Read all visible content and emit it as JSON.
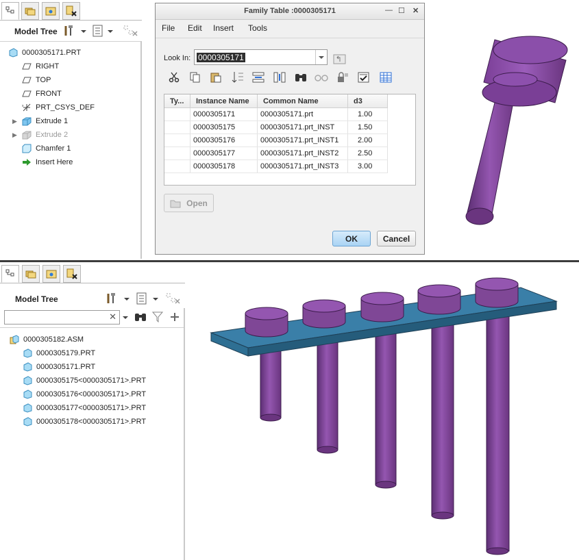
{
  "top": {
    "tree_title": "Model Tree",
    "tree": [
      {
        "label": "0000305171.PRT",
        "icon": "part-icon"
      },
      {
        "label": "RIGHT",
        "icon": "datum-plane-icon"
      },
      {
        "label": "TOP",
        "icon": "datum-plane-icon"
      },
      {
        "label": "FRONT",
        "icon": "datum-plane-icon"
      },
      {
        "label": "PRT_CSYS_DEF",
        "icon": "csys-icon"
      },
      {
        "label": "Extrude 1",
        "icon": "extrude-icon"
      },
      {
        "label": "Extrude 2",
        "icon": "extrude-icon"
      },
      {
        "label": "Chamfer 1",
        "icon": "chamfer-icon"
      },
      {
        "label": "Insert Here",
        "icon": "insert-arrow-icon"
      }
    ]
  },
  "dialog": {
    "title": "Family Table :0000305171",
    "menu": [
      "File",
      "Edit",
      "Insert",
      "Tools"
    ],
    "look_in_label": "Look In:",
    "look_in_value": "0000305171",
    "columns": [
      "Ty...",
      "Instance Name",
      "Common Name",
      "d3"
    ],
    "rows": [
      {
        "type": "",
        "instance": "0000305171",
        "common": "0000305171.prt",
        "d3": "1.00"
      },
      {
        "type": "",
        "instance": "0000305175",
        "common": "0000305171.prt_INST",
        "d3": "1.50"
      },
      {
        "type": "",
        "instance": "0000305176",
        "common": "0000305171.prt_INST1",
        "d3": "2.00"
      },
      {
        "type": "",
        "instance": "0000305177",
        "common": "0000305171.prt_INST2",
        "d3": "2.50"
      },
      {
        "type": "",
        "instance": "0000305178",
        "common": "0000305171.prt_INST3",
        "d3": "3.00"
      }
    ],
    "open_label": "Open",
    "ok_label": "OK",
    "cancel_label": "Cancel"
  },
  "bottom": {
    "tree_title": "Model Tree",
    "search_value": "",
    "tree": [
      {
        "label": "0000305182.ASM",
        "icon": "assembly-icon"
      },
      {
        "label": "0000305179.PRT",
        "icon": "part-icon"
      },
      {
        "label": "0000305171.PRT",
        "icon": "part-icon"
      },
      {
        "label": "0000305175<0000305171>.PRT",
        "icon": "part-icon"
      },
      {
        "label": "0000305176<0000305171>.PRT",
        "icon": "part-icon"
      },
      {
        "label": "0000305177<0000305171>.PRT",
        "icon": "part-icon"
      },
      {
        "label": "0000305178<0000305171>.PRT",
        "icon": "part-icon"
      }
    ]
  },
  "colors": {
    "part_purple": "#7f4796",
    "plate_blue": "#2e6f93",
    "ok_button": "#a9d3f4"
  }
}
